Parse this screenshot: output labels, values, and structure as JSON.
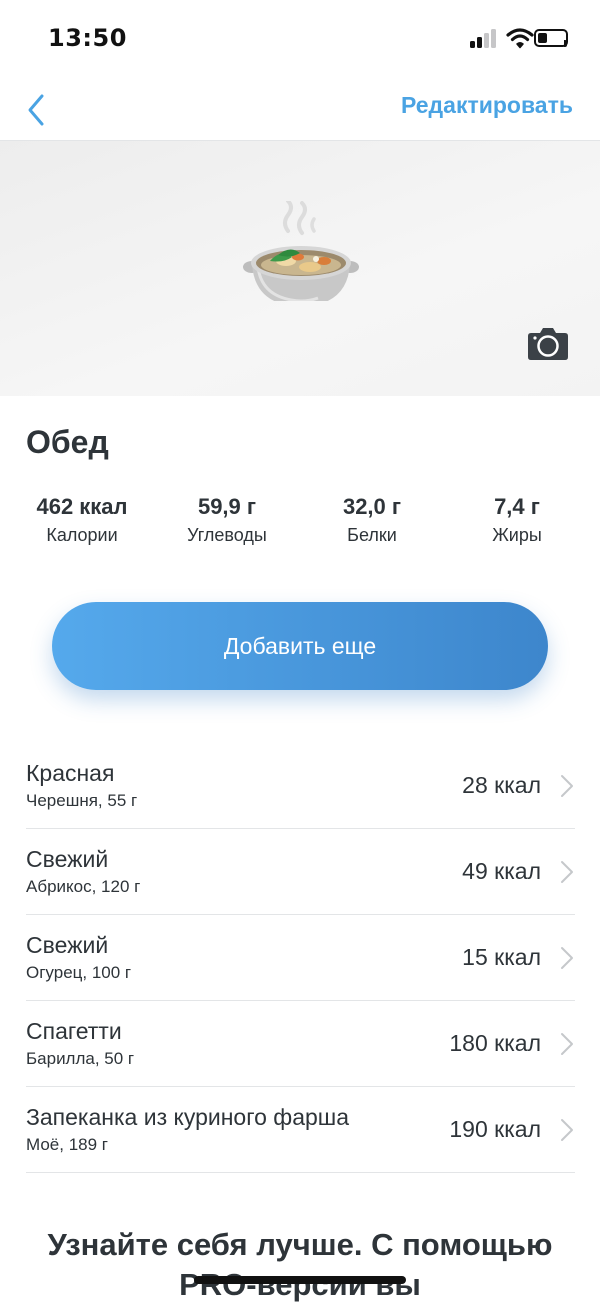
{
  "status_bar": {
    "time": "13:50",
    "icons": [
      "signal-icon",
      "wifi-icon",
      "battery-icon"
    ]
  },
  "nav": {
    "back_icon": "chevron-left-icon",
    "edit_label": "Редактировать",
    "accent_color": "#4aa3e3"
  },
  "photo": {
    "image_icon": "pot-of-food-icon",
    "camera_icon": "camera-icon"
  },
  "meal": {
    "title": "Обед",
    "nutrients": [
      {
        "value": "462 ккал",
        "label": "Калории"
      },
      {
        "value": "59,9 г",
        "label": "Углеводы"
      },
      {
        "value": "32,0 г",
        "label": "Белки"
      },
      {
        "value": "7,4 г",
        "label": "Жиры"
      }
    ]
  },
  "add_button": {
    "label": "Добавить еще",
    "gradient_colors": [
      "#55a9ec",
      "#3d86cc"
    ]
  },
  "food_items": [
    {
      "name": "Красная",
      "desc": "Черешня, 55 г",
      "kcal": "28 ккал"
    },
    {
      "name": "Свежий",
      "desc": "Абрикос, 120 г",
      "kcal": "49 ккал"
    },
    {
      "name": "Свежий",
      "desc": "Огурец, 100 г",
      "kcal": "15 ккал"
    },
    {
      "name": "Спагетти",
      "desc": "Барилла, 50 г",
      "kcal": "180 ккал"
    },
    {
      "name": "Запеканка из куриного фарша",
      "desc": "Моё, 189 г",
      "kcal": "190 ккал"
    }
  ],
  "promo": {
    "text": "Узнайте себя лучше. С помощью PRO-версии вы"
  }
}
